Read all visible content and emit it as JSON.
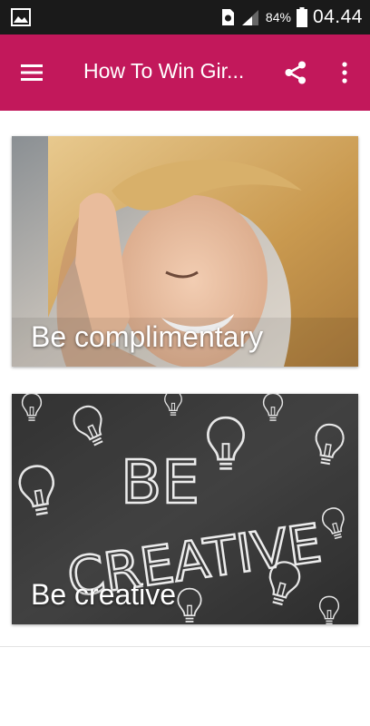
{
  "status_bar": {
    "battery_percent": "84%",
    "time": "04.44",
    "icons": [
      "gallery-icon",
      "sim-icon",
      "signal-icon",
      "battery-icon"
    ]
  },
  "app_bar": {
    "title": "How To Win Gir...",
    "background_color": "#c2185b",
    "icons": [
      "menu-icon",
      "share-icon",
      "more-vert-icon"
    ]
  },
  "cards": [
    {
      "caption": "Be complimentary"
    },
    {
      "caption": "Be creative",
      "image_text": [
        "BE",
        "CREATIVE"
      ]
    }
  ]
}
